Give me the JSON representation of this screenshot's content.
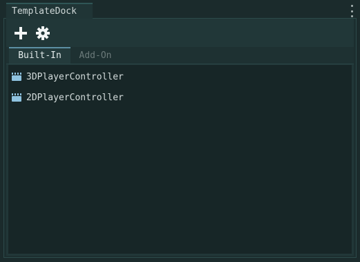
{
  "dock": {
    "tab_title": "TemplateDock",
    "menu_icon": "vertical-dots-icon"
  },
  "toolbar": {
    "add_icon": "plus-icon",
    "settings_icon": "gear-icon"
  },
  "tabs": [
    {
      "label": "Built-In",
      "active": true
    },
    {
      "label": "Add-On",
      "active": false
    }
  ],
  "list": {
    "items": [
      {
        "label": "3DPlayerController",
        "icon": "clapperboard-icon"
      },
      {
        "label": "2DPlayerController",
        "icon": "clapperboard-icon"
      }
    ]
  },
  "colors": {
    "background": "#1b2b2c",
    "panel": "#213738",
    "list_background": "#172627",
    "active_tab_accent": "#5c8fa3",
    "icon_blue": "#8fc3e0"
  }
}
